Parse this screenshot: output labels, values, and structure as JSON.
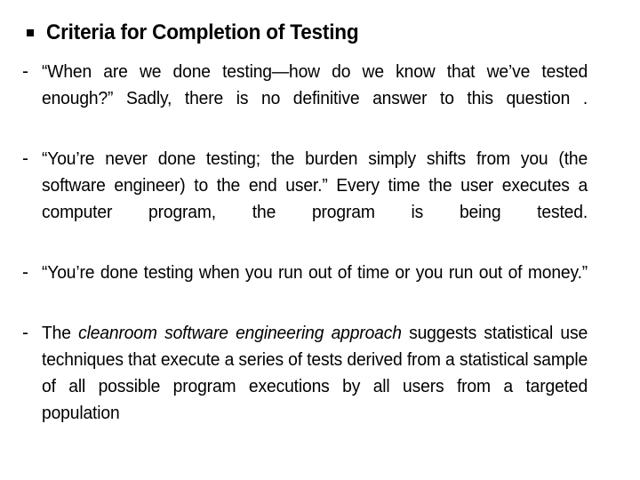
{
  "slide": {
    "background_color": "#ffffff",
    "text_color": "#000000",
    "heading": {
      "bullet_glyph": "square-bullet",
      "text": "Criteria for Completion of Testing"
    },
    "bullets": [
      {
        "marker": "-",
        "segments": [
          {
            "style": "normal",
            "text": "“When are we done testing—how do we know that we’ve tested enough?” Sadly, there is no definitive answer to this question ."
          }
        ]
      },
      {
        "marker": "-",
        "segments": [
          {
            "style": "normal",
            "text": "“You’re never done testing; the burden simply shifts from you (the software engineer) to the end user.” Every time the user executes a computer program, the program is being tested."
          }
        ]
      },
      {
        "marker": "-",
        "segments": [
          {
            "style": "normal",
            "text": "“You’re done testing when you run out of time or you run out of money.”"
          }
        ]
      },
      {
        "marker": "-",
        "segments": [
          {
            "style": "normal",
            "text": "The "
          },
          {
            "style": "italic",
            "text": "cleanroom software engineering approach"
          },
          {
            "style": "normal",
            "text": " suggests statistical use techniques that execute a series of tests derived from a statistical sample of all possible program executions by all users from a targeted population"
          }
        ]
      }
    ]
  }
}
